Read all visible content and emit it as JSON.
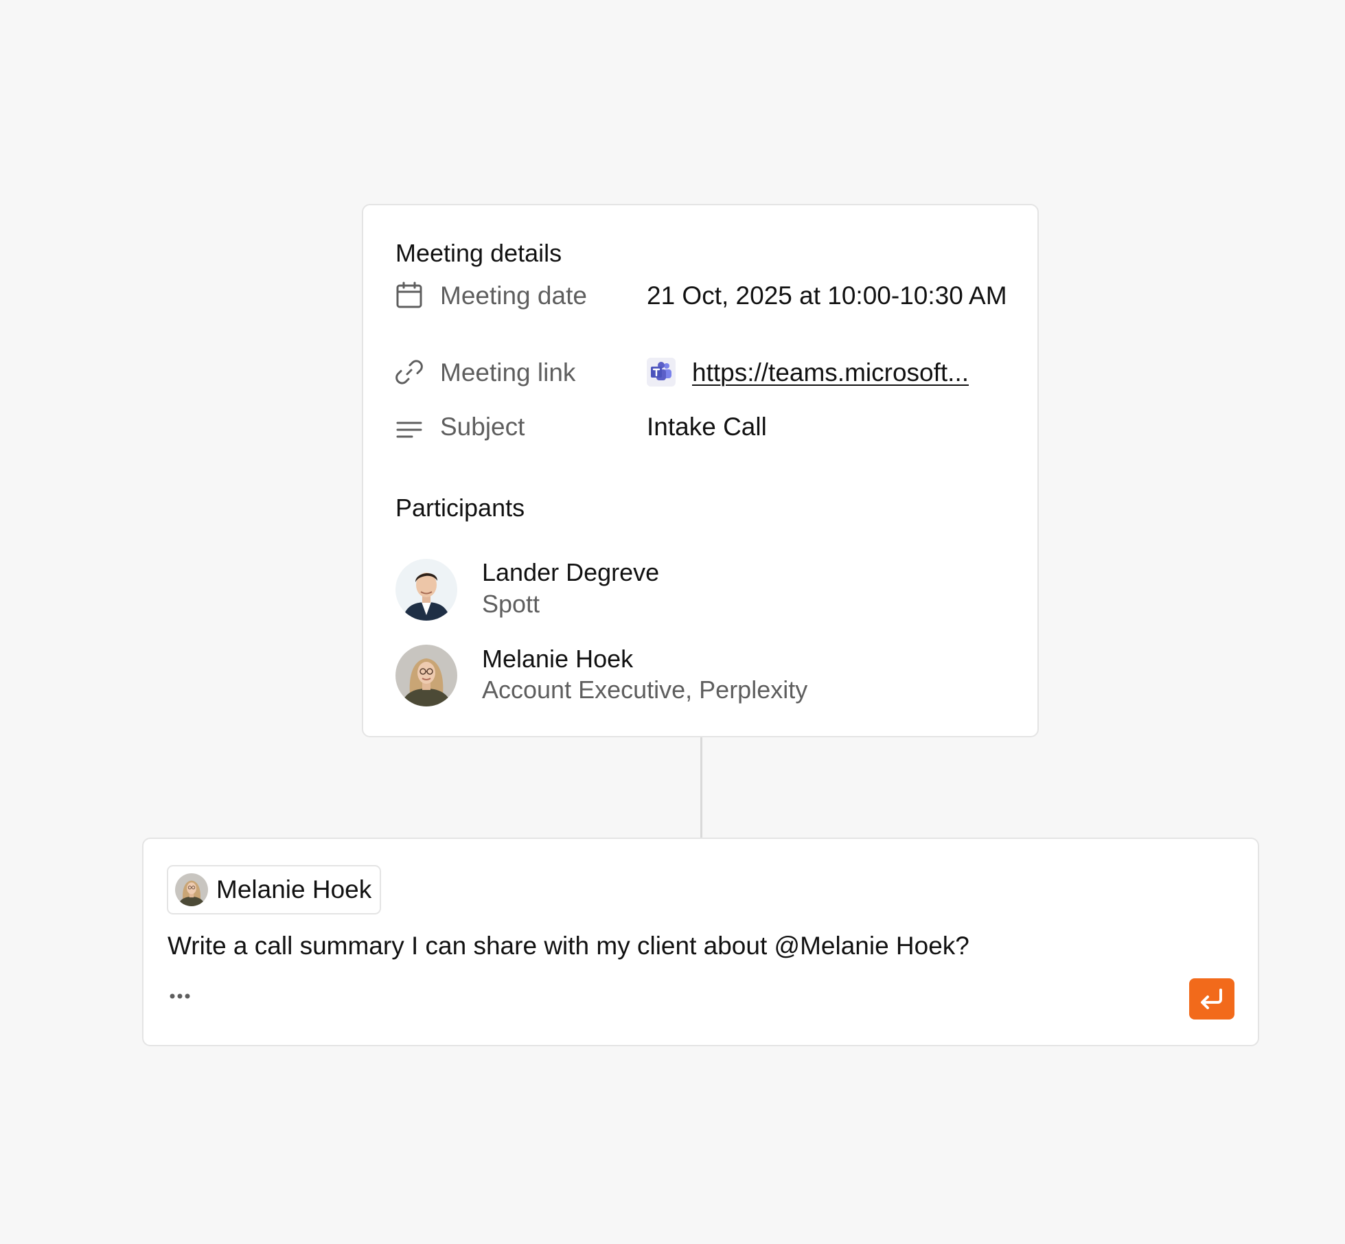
{
  "meeting_card": {
    "title": "Meeting details",
    "rows": {
      "date": {
        "icon": "calendar-icon",
        "label": "Meeting date",
        "value": "21 Oct, 2025 at 10:00-10:30 AM"
      },
      "link": {
        "icon": "link-icon",
        "label": "Meeting link",
        "app_icon": "microsoft-teams-icon",
        "value": "https://teams.microsoft..."
      },
      "subject": {
        "icon": "text-lines-icon",
        "label": "Subject",
        "value": "Intake Call"
      }
    },
    "participants_title": "Participants",
    "participants": [
      {
        "name": "Lander Degreve",
        "subtitle": "Spott",
        "avatar": "avatar-photo"
      },
      {
        "name": "Melanie Hoek",
        "subtitle": "Account Executive, Perplexity",
        "avatar": "avatar-photo"
      }
    ]
  },
  "chat_input": {
    "mention": {
      "name": "Melanie Hoek",
      "avatar": "avatar-photo"
    },
    "prompt": "Write a call summary I can share with my client about @Melanie Hoek?",
    "more_icon": "ellipsis-icon",
    "send_icon": "enter-return-icon"
  },
  "colors": {
    "background": "#f7f7f7",
    "card": "#ffffff",
    "border": "#e4e4e4",
    "accent": "#f26a1b",
    "muted_text": "#5e5e5e",
    "teams_brand": "#5b5fc7"
  }
}
